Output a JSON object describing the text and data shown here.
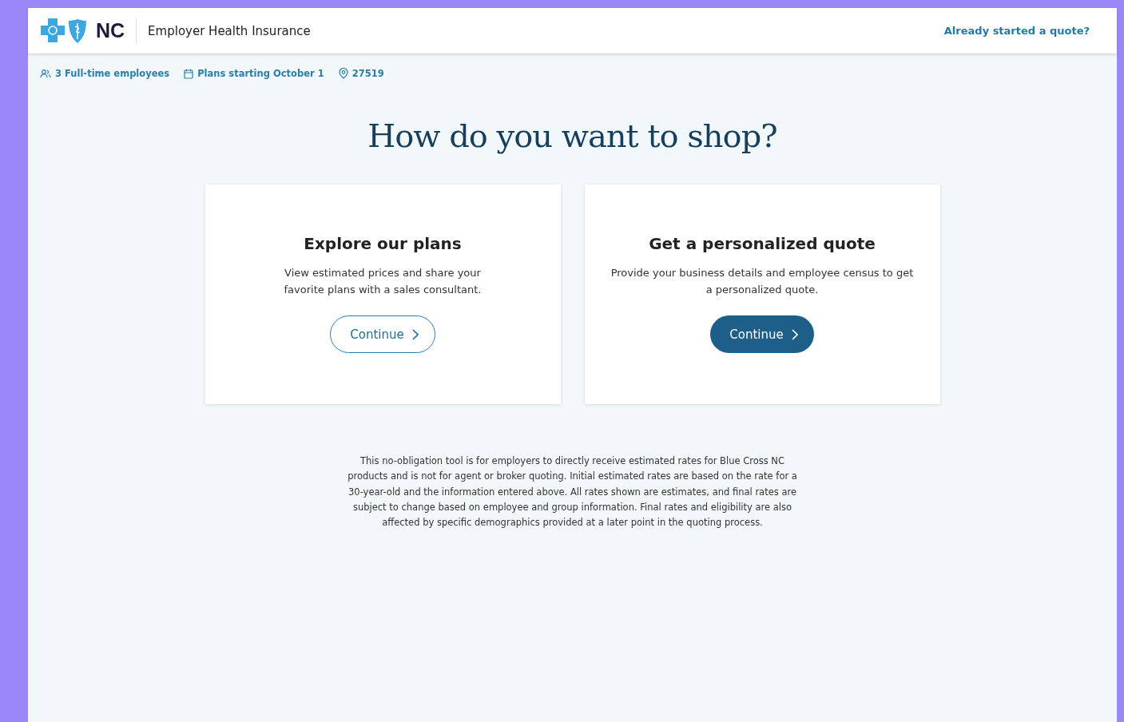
{
  "header": {
    "logo_text": "NC",
    "title": "Employer Health Insurance",
    "link": "Already started a quote?"
  },
  "summary": [
    {
      "kind": "people",
      "text": "3 Full-time employees"
    },
    {
      "kind": "calendar",
      "text": "Plans starting October 1"
    },
    {
      "kind": "location",
      "text": "27519"
    }
  ],
  "heading": "How do you want to shop?",
  "options": [
    {
      "title": "Explore our plans",
      "description": "View estimated prices and share your favorite plans with a sales consultant.",
      "button": {
        "label": "Continue",
        "kind": "outline"
      }
    },
    {
      "title": "Get a personalized quote",
      "description": "Provide your business details and employee census to get a personalized quote.",
      "button": {
        "label": "Continue",
        "kind": "filled"
      }
    }
  ],
  "disclaimer": "This no-obligation tool is for employers to directly receive estimated rates for Blue Cross NC products and is not for agent or broker quoting. Initial estimated rates are based on the rate for a 30-year-old and the information entered above. All rates shown are estimates, and final rates are subject to change based on employee and group information. Final rates and eligibility are also affected by specific demographics provided at a later point in the quoting process."
}
